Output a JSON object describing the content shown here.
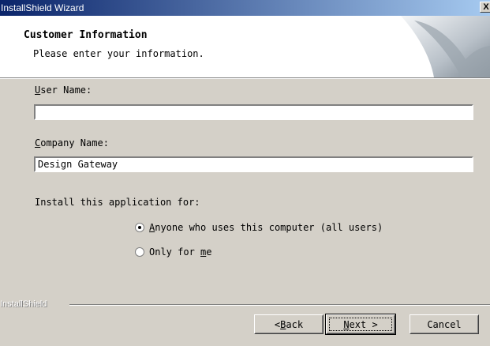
{
  "window": {
    "title": "InstallShield Wizard",
    "close_label": "X"
  },
  "header": {
    "title": "Customer Information",
    "subtitle": "Please enter your information."
  },
  "form": {
    "user_name": {
      "label_hotkey": "U",
      "label_rest": "ser Name:",
      "value": ""
    },
    "company_name": {
      "label_hotkey": "C",
      "label_rest": "ompany Name:",
      "value": "Design Gateway"
    },
    "install_for": {
      "label": "Install this application for:",
      "options": [
        {
          "hotkey": "A",
          "rest": "nyone who uses this computer (all users)",
          "checked": true
        },
        {
          "prefix": "Only for ",
          "hotkey": "m",
          "rest": "e",
          "checked": false
        }
      ]
    }
  },
  "footer": {
    "brand": "InstallShield"
  },
  "buttons": {
    "back": {
      "prefix": "< ",
      "hotkey": "B",
      "rest": "ack"
    },
    "next": {
      "hotkey": "N",
      "rest": "ext >"
    },
    "cancel": {
      "label": "Cancel"
    }
  }
}
